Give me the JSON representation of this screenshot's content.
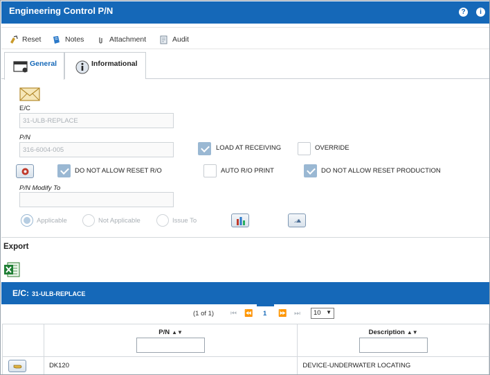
{
  "window": {
    "title": "Engineering Control P/N",
    "help_icon": "question-circle-icon",
    "info_icon": "info-circle-icon",
    "help_glyph": "?",
    "info_glyph": "i"
  },
  "toolbar": {
    "reset_label": "Reset",
    "notes_label": "Notes",
    "attachment_label": "Attachment",
    "audit_label": "Audit"
  },
  "tabs": [
    {
      "label": "General",
      "active": true
    },
    {
      "label": "Informational",
      "active": false
    }
  ],
  "form": {
    "ec_label": "E/C",
    "ec_value": "31-ULB-REPLACE",
    "pn_label": "P/N",
    "pn_value": "316-6004-005",
    "pn_modify_label": "P/N Modify To",
    "pn_modify_value": "",
    "checkboxes": {
      "load_at_receiving": {
        "label": "LOAD AT RECEIVING",
        "checked": true
      },
      "override": {
        "label": "OVERRIDE",
        "checked": false
      },
      "do_not_allow_reset_ro": {
        "label": "DO NOT ALLOW RESET R/O",
        "checked": true
      },
      "auto_ro_print": {
        "label": "AUTO R/O PRINT",
        "checked": false
      },
      "do_not_allow_reset_production": {
        "label": "DO NOT ALLOW RESET PRODUCTION",
        "checked": true
      }
    },
    "radios": [
      {
        "label": "Applicable",
        "selected": true
      },
      {
        "label": "Not Applicable",
        "selected": false
      },
      {
        "label": "Issue To",
        "selected": false
      }
    ]
  },
  "export": {
    "title": "Export",
    "excel_icon": "excel-export-icon"
  },
  "ec_bar": {
    "key": "E/C:",
    "value": "31-ULB-REPLACE"
  },
  "pager": {
    "summary": "(1 of 1)",
    "current_page": "1",
    "rows_per_page": "10"
  },
  "table": {
    "columns": [
      "P/N",
      "Description"
    ],
    "rows": [
      {
        "pn": "DK120",
        "description": "DEVICE-UNDERWATER LOCATING"
      }
    ]
  },
  "colors": {
    "header_blue": "#1568b8",
    "checked_box": "#9ab8d3"
  }
}
